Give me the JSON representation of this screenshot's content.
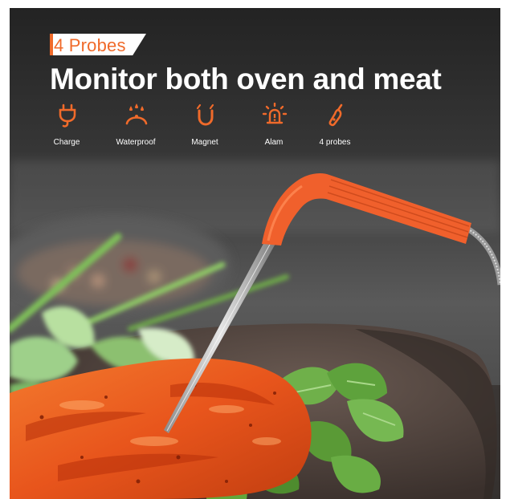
{
  "badge": {
    "text": "4 Probes"
  },
  "headline": {
    "text": "Monitor both oven and meat"
  },
  "features": [
    {
      "icon": "plug-icon",
      "label": "Charge"
    },
    {
      "icon": "water-drops-icon",
      "label": "Waterproof"
    },
    {
      "icon": "magnet-icon",
      "label": "Magnet"
    },
    {
      "icon": "alarm-icon",
      "label": "Alam"
    },
    {
      "icon": "probe-icon",
      "label": "4 probes"
    }
  ],
  "colors": {
    "accent": "#f06a2a",
    "background": "#2a2a2a",
    "probe_handle": "#f06030"
  }
}
